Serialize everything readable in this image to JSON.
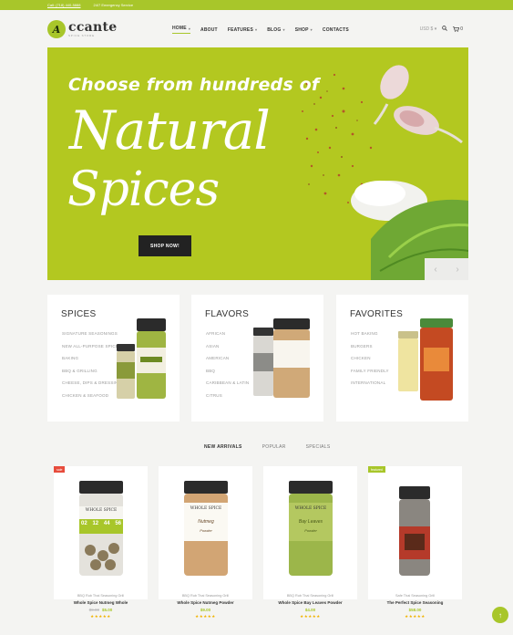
{
  "topbar": {
    "phone": "Call: (718) 440-5888",
    "support": "24/7 Emergency Service"
  },
  "logo": {
    "badge": "A",
    "name": "ccante",
    "tagline": "SPICE STORE"
  },
  "nav": {
    "items": [
      {
        "label": "HOME",
        "caret": true
      },
      {
        "label": "ABOUT",
        "caret": false
      },
      {
        "label": "FEATURES",
        "caret": true
      },
      {
        "label": "BLOG",
        "caret": true
      },
      {
        "label": "SHOP",
        "caret": true
      },
      {
        "label": "CONTACTS",
        "caret": false
      }
    ],
    "currency": "USD $",
    "cart_count": "0"
  },
  "hero": {
    "line1": "Choose from hundreds of",
    "line2": "Natural",
    "line3": "Spices",
    "button": "SHOP NOW!"
  },
  "categories": [
    {
      "title": "SPICES",
      "items": [
        "SIGNATURE SEASONINGS",
        "NEW ALL-PURPOSE SPICES",
        "BAKING",
        "BBQ & GRILLING",
        "CHEESE, DIPS & DRESSINGS",
        "CHICKEN & SEAFOOD"
      ]
    },
    {
      "title": "FLAVORS",
      "items": [
        "AFRICAN",
        "ASIAN",
        "AMERICAN",
        "BBQ",
        "CARIBBEAN & LATIN",
        "CITRUS"
      ]
    },
    {
      "title": "FAVORITES",
      "items": [
        "HOT BAKING",
        "BURGERS",
        "CHICKEN",
        "FAMILY FRIENDLY",
        "INTERNATIONAL"
      ]
    }
  ],
  "tabs": [
    "NEW ARRIVALS",
    "POPULAR",
    "SPECIALS"
  ],
  "products": [
    {
      "badge": "sale",
      "category": "BBQ Rub Thai Seasoning Grill",
      "name": "Whole Spice Nutmeg Whole",
      "price_old": "$9.00",
      "price": "$5.00",
      "rating": 0,
      "jar_label": "WHOLE SPICE",
      "timer": [
        "02",
        "12",
        "44",
        "56"
      ]
    },
    {
      "badge": "",
      "category": "BBQ Rub Thai Seasoning Grill",
      "name": "Whole Spice Nutmeg Powder",
      "price_old": "",
      "price": "$9.00",
      "rating": 0,
      "jar_label": "WHOLE SPICE",
      "jar_sub": "Nutmeg",
      "jar_sub2": "Powder"
    },
    {
      "badge": "",
      "category": "BBQ Rub Thai Seasoning Grill",
      "name": "Whole Spice Bay Leaves Powder",
      "price_old": "",
      "price": "$4.00",
      "rating": 0,
      "jar_label": "WHOLE SPICE",
      "jar_sub": "Bay Leaves",
      "jar_sub2": "Powder"
    },
    {
      "badge": "featured",
      "category": "Safe Thai Seasoning Grill",
      "name": "The Perfect Spice Seasoning",
      "price_old": "",
      "price": "$58.00",
      "rating": 0
    }
  ],
  "colors": {
    "accent": "#a8c62a",
    "hero_bg": "#b3c820",
    "dark": "#222222"
  },
  "icons": [
    "search-icon",
    "cart-icon",
    "chevron-left-icon",
    "chevron-right-icon",
    "arrow-up-icon"
  ]
}
